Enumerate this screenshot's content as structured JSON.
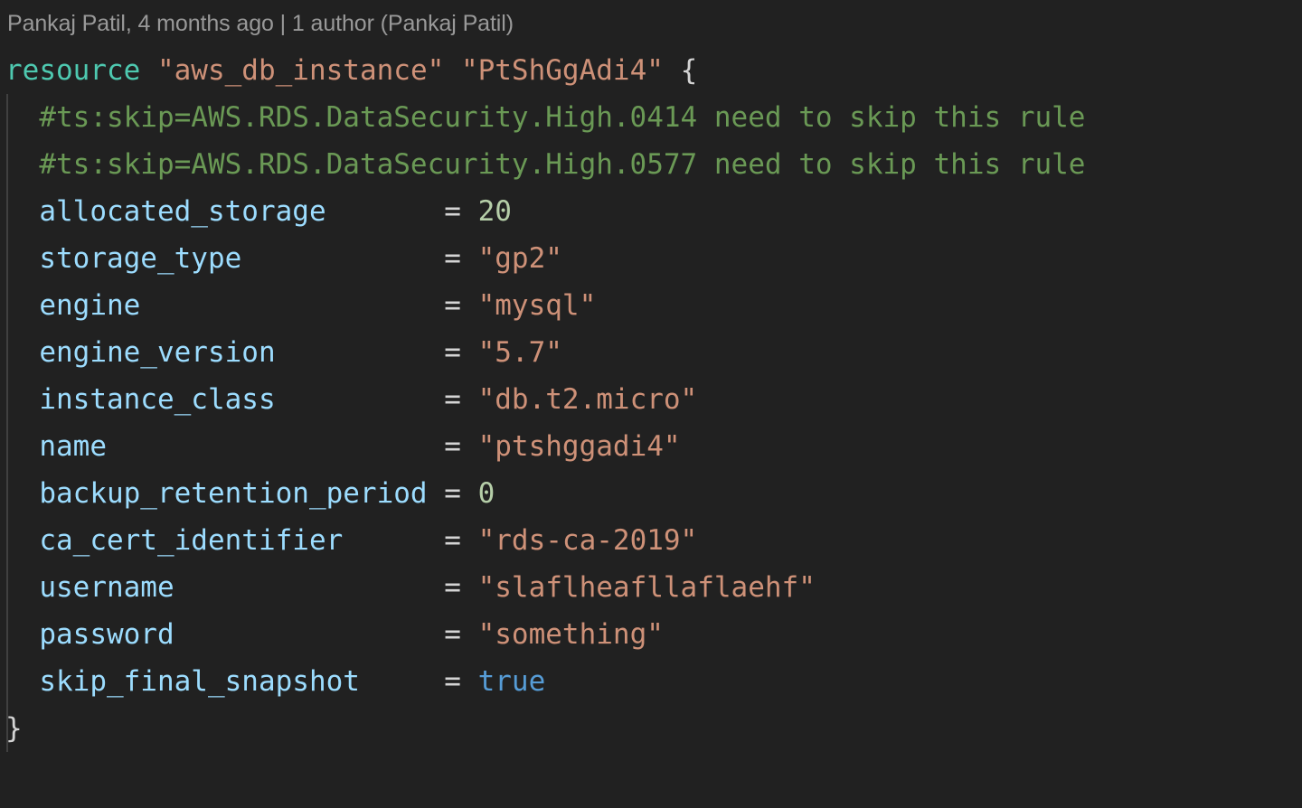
{
  "editor": {
    "background": "#212121",
    "font_size_px": 31,
    "line_height_px": 52,
    "indent_guide_color": "#404040"
  },
  "blame": {
    "name": "blame-annotation",
    "text": "Pankaj Patil, 4 months ago | 1 author (Pankaj Patil)",
    "color": "#999999"
  },
  "palette": {
    "keyword": "#4EC9B0",
    "string": "#CE9178",
    "comment": "#6A9955",
    "attribute": "#9CDCFE",
    "number": "#B5CEA8",
    "boolean": "#569CD6",
    "punctuation": "#D4D4D4",
    "operator": "#D4D4D4"
  },
  "code": {
    "language": "terraform",
    "resource_type": "aws_db_instance",
    "resource_name": "PtShGgAdi4",
    "lines": [
      {
        "number": 1,
        "indent": 0,
        "tokens": [
          {
            "t": "resource",
            "c": "keyword"
          },
          {
            "t": " ",
            "c": "plain"
          },
          {
            "t": "\"aws_db_instance\"",
            "c": "string"
          },
          {
            "t": " ",
            "c": "plain"
          },
          {
            "t": "\"PtShGgAdi4\"",
            "c": "string"
          },
          {
            "t": " ",
            "c": "plain"
          },
          {
            "t": "{",
            "c": "punct"
          }
        ]
      },
      {
        "number": 2,
        "indent": 2,
        "tokens": [
          {
            "t": "#ts:skip=AWS.RDS.DataSecurity.High.0414 need to skip this rule",
            "c": "comment"
          }
        ]
      },
      {
        "number": 3,
        "indent": 2,
        "tokens": [
          {
            "t": "#ts:skip=AWS.RDS.DataSecurity.High.0577 need to skip this rule",
            "c": "comment"
          }
        ]
      },
      {
        "number": 4,
        "indent": 2,
        "tokens": [
          {
            "t": "allocated_storage",
            "c": "attr"
          },
          {
            "t": "       = ",
            "c": "op"
          },
          {
            "t": "20",
            "c": "number"
          }
        ]
      },
      {
        "number": 5,
        "indent": 2,
        "tokens": [
          {
            "t": "storage_type",
            "c": "attr"
          },
          {
            "t": "            = ",
            "c": "op"
          },
          {
            "t": "\"gp2\"",
            "c": "string"
          }
        ]
      },
      {
        "number": 6,
        "indent": 2,
        "tokens": [
          {
            "t": "engine",
            "c": "attr"
          },
          {
            "t": "                  = ",
            "c": "op"
          },
          {
            "t": "\"mysql\"",
            "c": "string"
          }
        ]
      },
      {
        "number": 7,
        "indent": 2,
        "tokens": [
          {
            "t": "engine_version",
            "c": "attr"
          },
          {
            "t": "          = ",
            "c": "op"
          },
          {
            "t": "\"5.7\"",
            "c": "string"
          }
        ]
      },
      {
        "number": 8,
        "indent": 2,
        "tokens": [
          {
            "t": "instance_class",
            "c": "attr"
          },
          {
            "t": "          = ",
            "c": "op"
          },
          {
            "t": "\"db.t2.micro\"",
            "c": "string"
          }
        ]
      },
      {
        "number": 9,
        "indent": 2,
        "tokens": [
          {
            "t": "name",
            "c": "attr"
          },
          {
            "t": "                    = ",
            "c": "op"
          },
          {
            "t": "\"ptshggadi4\"",
            "c": "string"
          }
        ]
      },
      {
        "number": 10,
        "indent": 2,
        "tokens": [
          {
            "t": "backup_retention_period",
            "c": "attr"
          },
          {
            "t": " = ",
            "c": "op"
          },
          {
            "t": "0",
            "c": "number"
          }
        ]
      },
      {
        "number": 11,
        "indent": 2,
        "tokens": [
          {
            "t": "ca_cert_identifier",
            "c": "attr"
          },
          {
            "t": "      = ",
            "c": "op"
          },
          {
            "t": "\"rds-ca-2019\"",
            "c": "string"
          }
        ]
      },
      {
        "number": 12,
        "indent": 2,
        "tokens": [
          {
            "t": "username",
            "c": "attr"
          },
          {
            "t": "                = ",
            "c": "op"
          },
          {
            "t": "\"slaflheafllaflaehf\"",
            "c": "string"
          }
        ]
      },
      {
        "number": 13,
        "indent": 2,
        "tokens": [
          {
            "t": "password",
            "c": "attr"
          },
          {
            "t": "                = ",
            "c": "op"
          },
          {
            "t": "\"something\"",
            "c": "string"
          }
        ]
      },
      {
        "number": 14,
        "indent": 2,
        "tokens": [
          {
            "t": "skip_final_snapshot",
            "c": "attr"
          },
          {
            "t": "     = ",
            "c": "op"
          },
          {
            "t": "true",
            "c": "bool"
          }
        ]
      },
      {
        "number": 15,
        "indent": 0,
        "tokens": [
          {
            "t": "}",
            "c": "punct"
          }
        ]
      }
    ]
  }
}
